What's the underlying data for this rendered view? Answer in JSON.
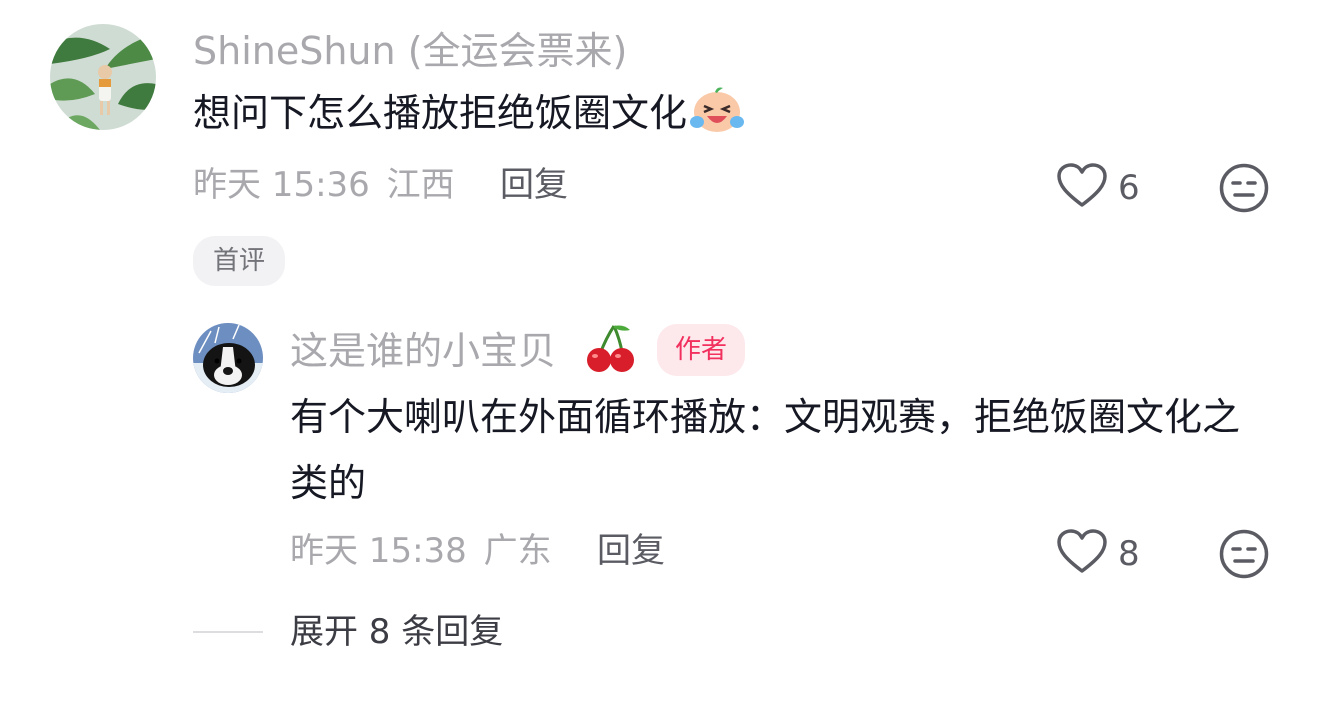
{
  "comment": {
    "username": "ShineShun",
    "username_suffix": "(全运会票来)",
    "text": "想问下怎么播放拒绝饭圈文化",
    "emoji_icon": "crying-laughing-face-icon",
    "time": "昨天 15:36",
    "location": "江西",
    "reply_label": "回复",
    "like_count": "6",
    "badge": "首评"
  },
  "reply": {
    "username": "这是谁的小宝贝",
    "name_emoji_icon": "cherry-icon",
    "author_badge": "作者",
    "text": "有个大喇叭在外面循环播放：文明观赛，拒绝饭圈文化之类的",
    "time": "昨天 15:38",
    "location": "广东",
    "reply_label": "回复",
    "like_count": "8"
  },
  "expand_replies_label": "展开 8 条回复",
  "colors": {
    "author_badge_text": "#f2305e",
    "author_badge_bg": "#fde8ec",
    "muted_text": "#a8a8ad"
  }
}
